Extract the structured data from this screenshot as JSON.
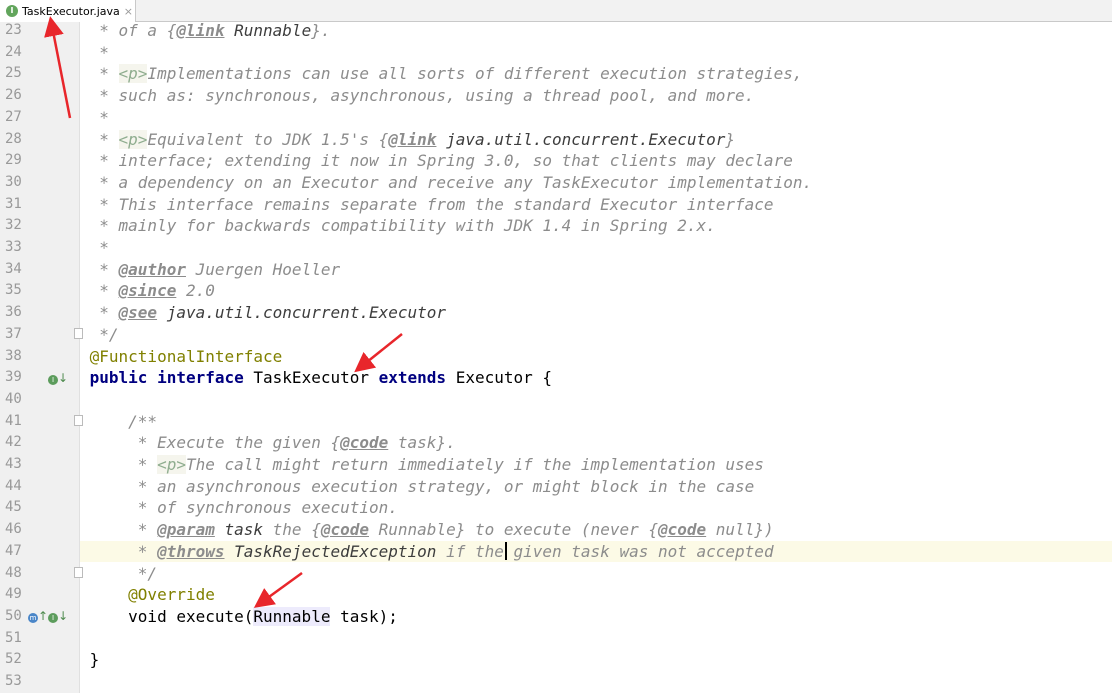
{
  "tab": {
    "filename": "TaskExecutor.java",
    "close_glyph": "×",
    "icon_letter": "I"
  },
  "lines": [
    {
      "n": "23",
      "segs": [
        {
          "t": "  * of a {",
          "c": "c"
        },
        {
          "t": "@link",
          "c": "jd"
        },
        {
          "t": " Runnable",
          "c": "ref"
        },
        {
          "t": "}.",
          "c": "c"
        }
      ]
    },
    {
      "n": "24",
      "segs": [
        {
          "t": "  *",
          "c": "c"
        }
      ]
    },
    {
      "n": "25",
      "segs": [
        {
          "t": "  * ",
          "c": "c"
        },
        {
          "t": "<p>",
          "c": "tag"
        },
        {
          "t": "Implementations can use all sorts of different execution strategies,",
          "c": "c"
        }
      ]
    },
    {
      "n": "26",
      "segs": [
        {
          "t": "  * such as: synchronous, asynchronous, using a thread pool, and more.",
          "c": "c"
        }
      ]
    },
    {
      "n": "27",
      "segs": [
        {
          "t": "  *",
          "c": "c"
        }
      ]
    },
    {
      "n": "28",
      "segs": [
        {
          "t": "  * ",
          "c": "c"
        },
        {
          "t": "<p>",
          "c": "tag"
        },
        {
          "t": "Equivalent to JDK 1.5's {",
          "c": "c"
        },
        {
          "t": "@link",
          "c": "jd"
        },
        {
          "t": " java.util.concurrent.Executor",
          "c": "ref"
        },
        {
          "t": "}",
          "c": "c"
        }
      ]
    },
    {
      "n": "29",
      "segs": [
        {
          "t": "  * interface; extending it now in Spring 3.0, so that clients may declare",
          "c": "c"
        }
      ]
    },
    {
      "n": "30",
      "segs": [
        {
          "t": "  * a dependency on an Executor and receive any TaskExecutor implementation.",
          "c": "c"
        }
      ]
    },
    {
      "n": "31",
      "segs": [
        {
          "t": "  * This interface remains separate from the standard Executor interface",
          "c": "c"
        }
      ]
    },
    {
      "n": "32",
      "segs": [
        {
          "t": "  * mainly for backwards compatibility with JDK 1.4 in Spring 2.x.",
          "c": "c"
        }
      ]
    },
    {
      "n": "33",
      "segs": [
        {
          "t": "  *",
          "c": "c"
        }
      ]
    },
    {
      "n": "34",
      "segs": [
        {
          "t": "  * ",
          "c": "c"
        },
        {
          "t": "@author",
          "c": "jd"
        },
        {
          "t": " Juergen Hoeller",
          "c": "c"
        }
      ]
    },
    {
      "n": "35",
      "segs": [
        {
          "t": "  * ",
          "c": "c"
        },
        {
          "t": "@since",
          "c": "jd"
        },
        {
          "t": " 2.0",
          "c": "c"
        }
      ]
    },
    {
      "n": "36",
      "segs": [
        {
          "t": "  * ",
          "c": "c"
        },
        {
          "t": "@see",
          "c": "jd"
        },
        {
          "t": " java.util.concurrent.Executor",
          "c": "ref"
        }
      ]
    },
    {
      "n": "37",
      "segs": [
        {
          "t": "  */",
          "c": "c"
        }
      ]
    },
    {
      "n": "38",
      "segs": [
        {
          "t": " @FunctionalInterface",
          "c": "ann"
        }
      ]
    },
    {
      "n": "39",
      "segs": [
        {
          "t": " public interface",
          "c": "kw"
        },
        {
          "t": " TaskExecutor ",
          "c": ""
        },
        {
          "t": "extends",
          "c": "kw"
        },
        {
          "t": " Executor {",
          "c": ""
        }
      ]
    },
    {
      "n": "40",
      "segs": [
        {
          "t": "",
          "c": ""
        }
      ]
    },
    {
      "n": "41",
      "segs": [
        {
          "t": "     /**",
          "c": "c"
        }
      ]
    },
    {
      "n": "42",
      "segs": [
        {
          "t": "      * Execute the given {",
          "c": "c"
        },
        {
          "t": "@code",
          "c": "jd"
        },
        {
          "t": " task}.",
          "c": "c"
        }
      ]
    },
    {
      "n": "43",
      "segs": [
        {
          "t": "      * ",
          "c": "c"
        },
        {
          "t": "<p>",
          "c": "tag"
        },
        {
          "t": "The call might return immediately if the implementation uses",
          "c": "c"
        }
      ]
    },
    {
      "n": "44",
      "segs": [
        {
          "t": "      * an asynchronous execution strategy, or might block in the case",
          "c": "c"
        }
      ]
    },
    {
      "n": "45",
      "segs": [
        {
          "t": "      * of synchronous execution.",
          "c": "c"
        }
      ]
    },
    {
      "n": "46",
      "segs": [
        {
          "t": "      * ",
          "c": "c"
        },
        {
          "t": "@param",
          "c": "jd"
        },
        {
          "t": " task",
          "c": "ref"
        },
        {
          "t": " the {",
          "c": "c"
        },
        {
          "t": "@code",
          "c": "jd"
        },
        {
          "t": " Runnable} to execute (never {",
          "c": "c"
        },
        {
          "t": "@code",
          "c": "jd"
        },
        {
          "t": " null})",
          "c": "c"
        }
      ]
    },
    {
      "n": "47",
      "segs": [
        {
          "t": "      * ",
          "c": "c"
        },
        {
          "t": "@throws",
          "c": "jd"
        },
        {
          "t": " TaskRejectedException",
          "c": "ref"
        },
        {
          "t": " if the given task was not accepted",
          "c": "c"
        }
      ]
    },
    {
      "n": "48",
      "segs": [
        {
          "t": "      */",
          "c": "c"
        }
      ]
    },
    {
      "n": "49",
      "segs": [
        {
          "t": "     @Override",
          "c": "ann"
        }
      ]
    },
    {
      "n": "50",
      "segs": [
        {
          "t": "     void execute(",
          "c": ""
        },
        {
          "t": "Runnable",
          "c": "rn"
        },
        {
          "t": " task);",
          "c": ""
        }
      ]
    },
    {
      "n": "51",
      "segs": [
        {
          "t": "",
          "c": ""
        }
      ]
    },
    {
      "n": "52",
      "segs": [
        {
          "t": " }",
          "c": ""
        }
      ]
    },
    {
      "n": "53",
      "segs": [
        {
          "t": "",
          "c": ""
        }
      ]
    }
  ],
  "colors": {
    "annotation_arrow": "#e8262b",
    "current_line": "#fcfae6"
  }
}
